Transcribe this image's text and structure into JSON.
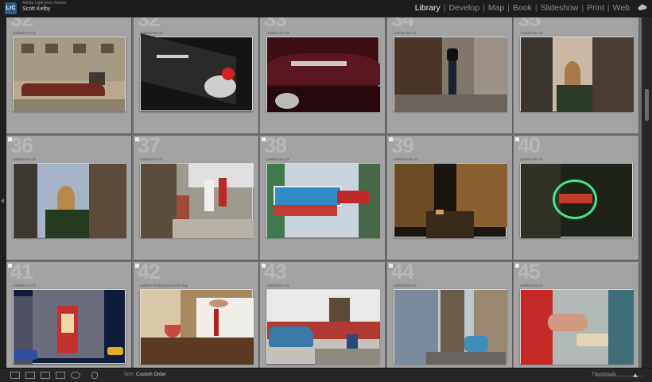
{
  "app": {
    "logo_text": "LrC",
    "app_name": "Adobe Lightroom Classic",
    "user_name": "Scott Kelby"
  },
  "modules": [
    {
      "label": "Library",
      "active": true
    },
    {
      "label": "Develop",
      "active": false
    },
    {
      "label": "Map",
      "active": false
    },
    {
      "label": "Book",
      "active": false
    },
    {
      "label": "Slideshow",
      "active": false
    },
    {
      "label": "Print",
      "active": false
    },
    {
      "label": "Web",
      "active": false
    }
  ],
  "grid": {
    "cells": [
      {
        "num": "32",
        "file": "untitled-37.cr3",
        "scene": "building-car"
      },
      {
        "num": "32",
        "file": "untitled-39.cr3",
        "scene": "car-fin"
      },
      {
        "num": "33",
        "file": "untitled-44.cr3",
        "scene": "car-hood"
      },
      {
        "num": "34",
        "file": "untitled-46.cr3",
        "scene": "man-door"
      },
      {
        "num": "35",
        "file": "untitled-45.cr3",
        "scene": "street-dome"
      },
      {
        "num": "36",
        "file": "untitled-52.cr3",
        "scene": "street-dome-2"
      },
      {
        "num": "37",
        "file": "untitled-57.cr3",
        "scene": "street-people"
      },
      {
        "num": "38",
        "file": "untitled-25.cr3",
        "scene": "neon-sign"
      },
      {
        "num": "39",
        "file": "untitled-163.cr3",
        "scene": "night-street"
      },
      {
        "num": "40",
        "file": "untitled-36.cr3",
        "scene": "neon-green"
      },
      {
        "num": "41",
        "file": "untitled-37.cr3",
        "scene": "night-building"
      },
      {
        "num": "42",
        "file": "untitled-75-Enhanced-NR.dng",
        "scene": "bartender"
      },
      {
        "num": "43",
        "file": "untitled-84.cr3",
        "scene": "blue-car"
      },
      {
        "num": "44",
        "file": "untitled-95.cr3",
        "scene": "alley-car"
      },
      {
        "num": "45",
        "file": "untitled-54.cr3",
        "scene": "hands-wall"
      }
    ]
  },
  "toolbar": {
    "sort_label": "Sort:",
    "sort_value": "Custom Order",
    "thumbnails_label": "Thumbnails"
  },
  "colors": {
    "accent": "#f0f0f0",
    "grid_bg": "#6f6f6f",
    "cell_bg": "#a3a3a3"
  }
}
